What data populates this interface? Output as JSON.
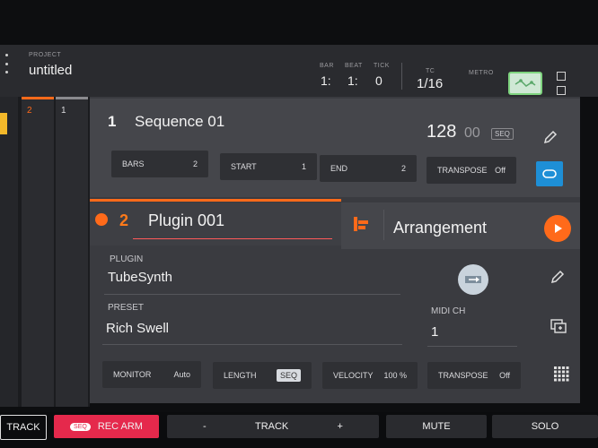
{
  "header": {
    "project_label": "PROJECT",
    "project_name": "untitled",
    "bar_label": "BAR",
    "bar_value": "1:",
    "beat_label": "BEAT",
    "beat_value": "1:",
    "tick_label": "TICK",
    "tick_value": "0",
    "tc_label": "TC",
    "tc_value": "1/16",
    "metro_label": "METRO"
  },
  "tracks_strip": {
    "track1_num": "2",
    "track2_num": "1"
  },
  "sequence": {
    "number": "1",
    "name": "Sequence 01",
    "tempo": "128",
    "tempo_decimal": "00",
    "tempo_tag": "SEQ",
    "bars_label": "BARS",
    "bars_value": "2",
    "start_label": "START",
    "start_value": "1",
    "end_label": "END",
    "end_value": "2",
    "transpose_label": "TRANSPOSE",
    "transpose_value": "Off"
  },
  "track": {
    "number": "2",
    "name": "Plugin 001",
    "arrangement_label": "Arrangement",
    "plugin_label": "PLUGIN",
    "plugin_value": "TubeSynth",
    "preset_label": "PRESET",
    "preset_value": "Rich Swell",
    "midi_label": "MIDI CH",
    "midi_value": "1",
    "monitor_label": "MONITOR",
    "monitor_value": "Auto",
    "length_label": "LENGTH",
    "length_value": "SEQ",
    "velocity_label": "VELOCITY",
    "velocity_value": "100 %",
    "transpose_label": "TRANSPOSE",
    "transpose_value": "Off"
  },
  "bottom": {
    "track_btn": "TRACK",
    "rec_tag": "SEQ",
    "rec_arm": "REC ARM",
    "minus": "-",
    "track_center": "TRACK",
    "plus": "+",
    "mute": "MUTE",
    "solo": "SOLO"
  },
  "colors": {
    "accent_orange": "#ff6a1a",
    "rec_red": "#e5294c",
    "loop_blue": "#1e8fd6"
  }
}
